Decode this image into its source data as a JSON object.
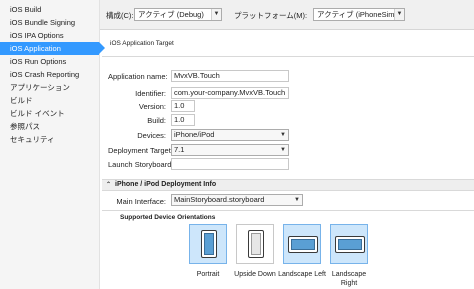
{
  "sidebar": {
    "items": [
      {
        "label": "iOS Build",
        "selected": false
      },
      {
        "label": "iOS Bundle Signing",
        "selected": false
      },
      {
        "label": "iOS IPA Options",
        "selected": false
      },
      {
        "label": "iOS Application",
        "selected": true
      },
      {
        "label": "iOS Run Options",
        "selected": false
      },
      {
        "label": "iOS Crash Reporting",
        "selected": false
      },
      {
        "label": "アプリケーション",
        "selected": false
      },
      {
        "label": "ビルド",
        "selected": false
      },
      {
        "label": "ビルド イベント",
        "selected": false
      },
      {
        "label": "参照パス",
        "selected": false
      },
      {
        "label": "セキュリティ",
        "selected": false
      }
    ]
  },
  "toolbar": {
    "config_label": "構成(C):",
    "config_value": "アクティブ (Debug)",
    "platform_label": "プラットフォーム(M):",
    "platform_value": "アクティブ (iPhoneSimulat"
  },
  "section": {
    "title": "iOS Application Target"
  },
  "fields": {
    "app_name_label": "Application name:",
    "app_name_value": "MvxVB.Touch",
    "identifier_label": "Identifier:",
    "identifier_value": "com.your-company.MvxVB.Touch",
    "version_label": "Version:",
    "version_value": "1.0",
    "build_label": "Build:",
    "build_value": "1.0",
    "devices_label": "Devices:",
    "devices_value": "iPhone/iPod",
    "deployment_target_label": "Deployment Target:",
    "deployment_target_value": "7.1",
    "launch_storyboard_label": "Launch Storyboard:",
    "launch_storyboard_value": ""
  },
  "deployment": {
    "header": "iPhone / iPod Deployment Info",
    "main_interface_label": "Main Interface:",
    "main_interface_value": "MainStoryboard.storyboard"
  },
  "orientations": {
    "title": "Supported Device Orientations",
    "items": [
      {
        "label": "Portrait",
        "selected": true
      },
      {
        "label": "Upside Down",
        "selected": false
      },
      {
        "label": "Landscape Left",
        "selected": true
      },
      {
        "label": "Landscape Right",
        "selected": true
      }
    ]
  },
  "colors": {
    "accent": "#3399ff",
    "selected_tile": "#cde6fb"
  },
  "icons": {
    "dropdown": "chevron-down-icon",
    "collapse": "collapse-icon"
  }
}
